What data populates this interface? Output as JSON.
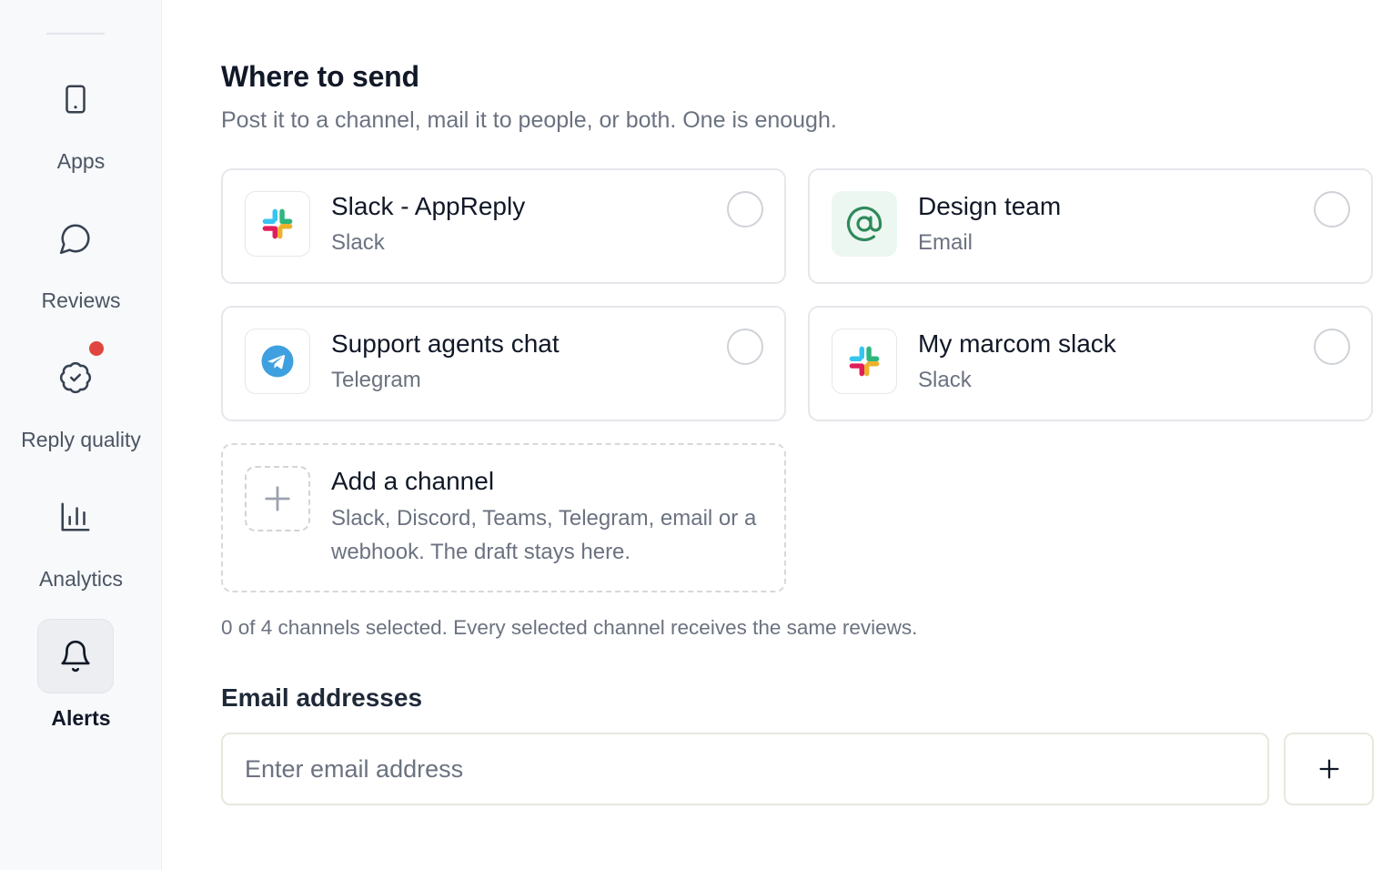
{
  "sidebar": {
    "items": [
      {
        "label": "Apps",
        "icon": "tablet-icon",
        "active": false
      },
      {
        "label": "Reviews",
        "icon": "message-icon",
        "active": false
      },
      {
        "label": "Reply quality",
        "icon": "badge-check-icon",
        "active": false,
        "notification": true
      },
      {
        "label": "Analytics",
        "icon": "bar-chart-icon",
        "active": false
      },
      {
        "label": "Alerts",
        "icon": "bell-icon",
        "active": true
      }
    ]
  },
  "main": {
    "title": "Where to send",
    "subtitle": "Post it to a channel, mail it to people, or both. One is enough.",
    "channels": [
      {
        "name": "Slack - AppReply",
        "type": "Slack",
        "icon": "slack-icon",
        "selected": false
      },
      {
        "name": "Design team",
        "type": "Email",
        "icon": "at-sign-icon",
        "selected": false
      },
      {
        "name": "Support agents chat",
        "type": "Telegram",
        "icon": "telegram-icon",
        "selected": false
      },
      {
        "name": "My marcom slack",
        "type": "Slack",
        "icon": "slack-icon",
        "selected": false
      }
    ],
    "add_channel": {
      "title": "Add a channel",
      "description": "Slack, Discord, Teams, Telegram, email or a webhook. The draft stays here.",
      "icon": "plus-icon"
    },
    "selected_note": "0 of 4 channels selected. Every selected channel receives the same reviews.",
    "email": {
      "heading": "Email addresses",
      "placeholder": "Enter email address",
      "value": "",
      "add_icon": "plus-icon"
    }
  },
  "colors": {
    "notification": "#e0463f",
    "sidebar_bg": "#f8f9fb",
    "email_icon_bg": "#edf7f1",
    "email_icon": "#2f8a5b",
    "telegram": "#3fa0e0",
    "slack_blue": "#36c5f0",
    "slack_green": "#2eb67d",
    "slack_yellow": "#ecb22e",
    "slack_red": "#e01e5a"
  }
}
